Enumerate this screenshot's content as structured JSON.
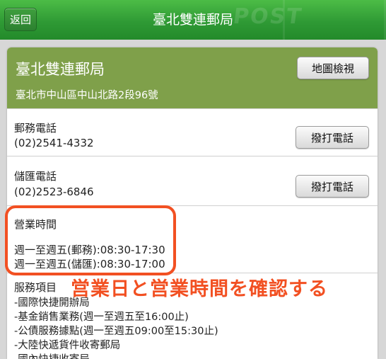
{
  "topbar": {
    "back_label": "返回",
    "title": "臺北雙連郵局"
  },
  "header": {
    "name": "臺北雙連郵局",
    "address": "臺北市中山區中山北路2段96號",
    "map_button": "地圖檢視"
  },
  "postal_phone": {
    "label": "郵務電話",
    "number": "(02)2541-4332",
    "call_button": "撥打電話"
  },
  "savings_phone": {
    "label": "儲匯電話",
    "number": "(02)2523-6846",
    "call_button": "撥打電話"
  },
  "hours": {
    "label": "營業時間",
    "lines": [
      "週一至週五(郵務):08:30-17:30",
      "週一至週五(儲匯):08:30-17:00"
    ]
  },
  "annotation": {
    "text": "営業日と営業時間を確認する",
    "color": "#f25022"
  },
  "services": {
    "label": "服務項目",
    "items": [
      "-國際快捷開辦局",
      "-基金銷售業務(週一至週五至16:00止)",
      "-公債服務據點(週一至週五09:00至15:30止)",
      "-大陸快遞貨件收寄郵局",
      "-國內快捷收寄局"
    ]
  },
  "colors": {
    "header_green": "#7fa04a",
    "topbar_green": "#2f9a35"
  }
}
